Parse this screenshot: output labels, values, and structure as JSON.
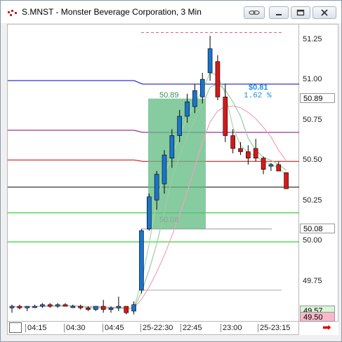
{
  "window": {
    "title": "S.MNST - Monster Beverage Corporation, 3 Min",
    "buttons": [
      "link-icon",
      "minimize-icon",
      "maximize-icon",
      "close-icon"
    ]
  },
  "y_axis": {
    "ticks": [
      "51.25",
      "51.00",
      "50.75",
      "50.50",
      "50.25",
      "50.00",
      "49.75"
    ],
    "tags": [
      {
        "name": "last-price-tag",
        "text": "50.89",
        "bg": "#ffffff",
        "color": "#000000"
      },
      {
        "name": "stop-price-tag",
        "text": "50.08",
        "bg": "#ffffff",
        "color": "#000000"
      },
      {
        "name": "bid-price-tag",
        "text": "49.57",
        "bg": "#d8f5d8",
        "color": "#000000"
      },
      {
        "name": "ask-price-tag",
        "text": "49.50",
        "bg": "#f7b8c8",
        "color": "#000000"
      }
    ]
  },
  "x_axis": {
    "labels": [
      "04:15",
      "04:30",
      "04:45",
      "25-22:30",
      "22:45",
      "23:00",
      "25-23:15"
    ]
  },
  "measure": {
    "start_label": "50.89",
    "end_label": "50.08",
    "change": "$0.81",
    "percent": "1.62 %",
    "accent": "#1f8fe0",
    "fill": "#5fba80"
  },
  "colors": {
    "up_candle": "#1874cd",
    "down_candle": "#d81818",
    "blue_line": "#0000cc",
    "purple_line": "#800080",
    "red_line": "#cc0000",
    "black_line": "#000000",
    "green_line": "#00cc00"
  },
  "chart_data": {
    "type": "candlestick",
    "y_range": [
      49.5,
      51.35
    ],
    "candles": [
      {
        "o": 49.59,
        "h": 49.61,
        "l": 49.56,
        "c": 49.6
      },
      {
        "o": 49.6,
        "h": 49.61,
        "l": 49.58,
        "c": 49.59
      },
      {
        "o": 49.59,
        "h": 49.6,
        "l": 49.57,
        "c": 49.6
      },
      {
        "o": 49.6,
        "h": 49.61,
        "l": 49.59,
        "c": 49.6
      },
      {
        "o": 49.6,
        "h": 49.62,
        "l": 49.59,
        "c": 49.61
      },
      {
        "o": 49.61,
        "h": 49.62,
        "l": 49.59,
        "c": 49.6
      },
      {
        "o": 49.6,
        "h": 49.62,
        "l": 49.59,
        "c": 49.61
      },
      {
        "o": 49.61,
        "h": 49.62,
        "l": 49.6,
        "c": 49.6
      },
      {
        "o": 49.6,
        "h": 49.61,
        "l": 49.59,
        "c": 49.6
      },
      {
        "o": 49.6,
        "h": 49.61,
        "l": 49.58,
        "c": 49.59
      },
      {
        "o": 49.59,
        "h": 49.6,
        "l": 49.57,
        "c": 49.58
      },
      {
        "o": 49.58,
        "h": 49.6,
        "l": 49.57,
        "c": 49.6
      },
      {
        "o": 49.6,
        "h": 49.64,
        "l": 49.56,
        "c": 49.58
      },
      {
        "o": 49.58,
        "h": 49.6,
        "l": 49.56,
        "c": 49.59
      },
      {
        "o": 49.59,
        "h": 49.66,
        "l": 49.57,
        "c": 49.6
      },
      {
        "o": 49.6,
        "h": 49.6,
        "l": 49.55,
        "c": 49.56
      },
      {
        "o": 49.57,
        "h": 49.63,
        "l": 49.55,
        "c": 49.61
      },
      {
        "o": 49.7,
        "h": 50.08,
        "l": 49.68,
        "c": 50.07
      },
      {
        "o": 50.08,
        "h": 50.3,
        "l": 50.07,
        "c": 50.28
      },
      {
        "o": 50.26,
        "h": 50.44,
        "l": 50.2,
        "c": 50.42
      },
      {
        "o": 50.36,
        "h": 50.57,
        "l": 50.3,
        "c": 50.54
      },
      {
        "o": 50.52,
        "h": 50.7,
        "l": 50.46,
        "c": 50.66
      },
      {
        "o": 50.66,
        "h": 50.82,
        "l": 50.62,
        "c": 50.78
      },
      {
        "o": 50.78,
        "h": 50.92,
        "l": 50.74,
        "c": 50.87
      },
      {
        "o": 50.84,
        "h": 50.98,
        "l": 50.8,
        "c": 50.94
      },
      {
        "o": 50.9,
        "h": 51.05,
        "l": 50.86,
        "c": 51.01
      },
      {
        "o": 51.05,
        "h": 51.28,
        "l": 51.0,
        "c": 51.2
      },
      {
        "o": 51.12,
        "h": 51.16,
        "l": 50.88,
        "c": 50.9
      },
      {
        "o": 50.9,
        "h": 50.98,
        "l": 50.62,
        "c": 50.66
      },
      {
        "o": 50.66,
        "h": 50.7,
        "l": 50.55,
        "c": 50.58
      },
      {
        "o": 50.58,
        "h": 50.62,
        "l": 50.54,
        "c": 50.56
      },
      {
        "o": 50.56,
        "h": 50.6,
        "l": 50.48,
        "c": 50.52
      },
      {
        "o": 50.58,
        "h": 50.64,
        "l": 50.5,
        "c": 50.52
      },
      {
        "o": 50.52,
        "h": 50.53,
        "l": 50.42,
        "c": 50.45
      },
      {
        "o": 50.47,
        "h": 50.49,
        "l": 50.44,
        "c": 50.48
      },
      {
        "o": 50.48,
        "h": 50.5,
        "l": 50.44,
        "c": 50.44
      },
      {
        "o": 50.43,
        "h": 50.43,
        "l": 50.33,
        "c": 50.33
      }
    ],
    "levels": [
      {
        "name": "blue",
        "value": 50.98
      },
      {
        "name": "purple",
        "value": 50.68
      },
      {
        "name": "red",
        "value": 50.5
      },
      {
        "name": "black",
        "value": 50.34
      },
      {
        "name": "green-upper",
        "value": 50.18
      },
      {
        "name": "green-lower",
        "value": 50.0
      }
    ]
  }
}
